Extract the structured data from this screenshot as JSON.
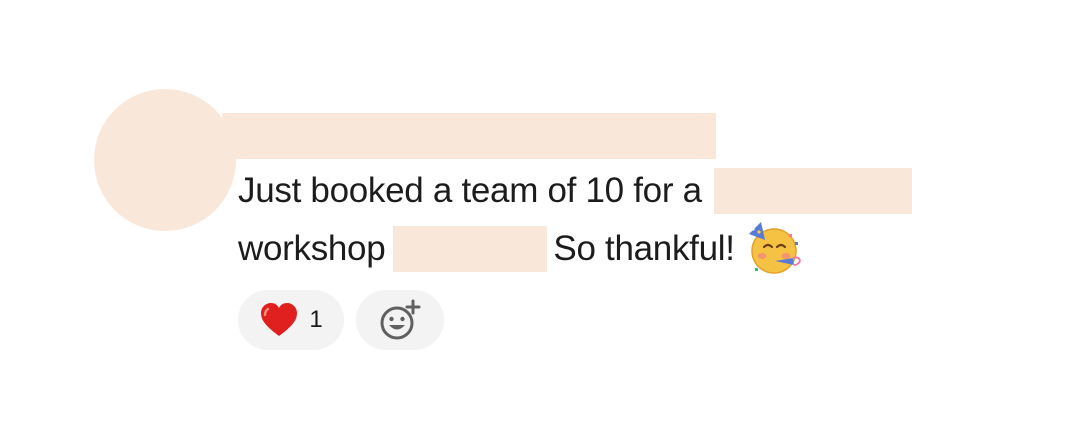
{
  "message": {
    "line1_text": "Just booked a team of 10 for a",
    "line2_text_a": "workshop",
    "line2_text_b": "So thankful!",
    "inline_emoji": "partying-face-icon"
  },
  "reactions": [
    {
      "emoji": "red-heart-icon",
      "count": "1"
    }
  ],
  "add_reaction": {
    "icon": "add-reaction-icon"
  },
  "colors": {
    "redaction": "#f9e7da",
    "text": "#1d1c1d",
    "pill_background": "#f3f3f3",
    "heart": "#e0201e"
  }
}
